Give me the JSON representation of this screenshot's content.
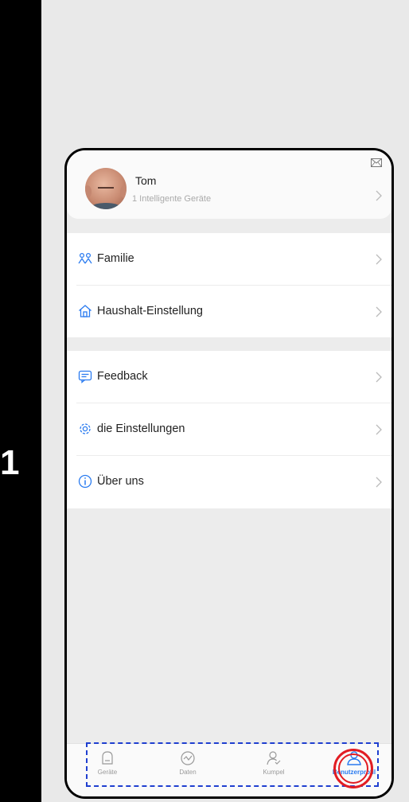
{
  "step_number": "1",
  "profile": {
    "name": "Tom",
    "subtitle": "1 Intelligente Geräte"
  },
  "menu_groups": [
    {
      "items": [
        {
          "label": "Familie",
          "icon": "family-icon"
        },
        {
          "label": "Haushalt-Einstellung",
          "icon": "home-icon"
        }
      ]
    },
    {
      "items": [
        {
          "label": "Feedback",
          "icon": "feedback-icon"
        },
        {
          "label": "die Einstellungen",
          "icon": "settings-gear-icon"
        },
        {
          "label": "Über uns",
          "icon": "info-icon"
        }
      ]
    }
  ],
  "tabbar": {
    "tabs": [
      {
        "label": "Geräte",
        "icon": "devices-icon",
        "active": false
      },
      {
        "label": "Daten",
        "icon": "data-chart-icon",
        "active": false
      },
      {
        "label": "Kumpel",
        "icon": "friend-icon",
        "active": false
      },
      {
        "label": "Benutzerprofil",
        "icon": "user-profile-icon",
        "active": true
      }
    ]
  },
  "colors": {
    "accent": "#2a7bf0",
    "highlight": "#e21c23",
    "dashed_outline": "#1f3fd0"
  }
}
